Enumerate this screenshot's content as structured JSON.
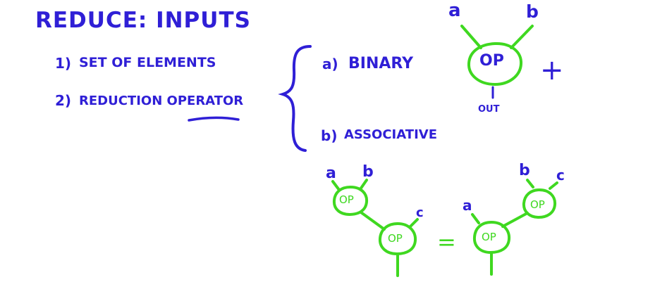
{
  "heading": "REDUCE: INPUTS",
  "inputs": [
    {
      "num": "1)",
      "text": "SET OF ELEMENTS"
    },
    {
      "num": "2)",
      "text": "REDUCTION OPERATOR"
    }
  ],
  "properties": [
    {
      "letter": "a)",
      "text": "BINARY"
    },
    {
      "letter": "b)",
      "text": "ASSOCIATIVE"
    }
  ],
  "binary_diagram": {
    "input_a": "a",
    "input_b": "b",
    "node": "OP",
    "output": "OUT",
    "example": "+"
  },
  "assoc_diagram": {
    "left": {
      "a": "a",
      "b": "b",
      "c": "c",
      "node_top": "OP",
      "node_bottom": "OP"
    },
    "equals": "=",
    "right": {
      "a": "a",
      "b": "b",
      "c": "c",
      "node_top": "OP",
      "node_bottom": "OP"
    }
  },
  "colors": {
    "text": "#2f1fd6",
    "diagram": "#3fd820"
  }
}
